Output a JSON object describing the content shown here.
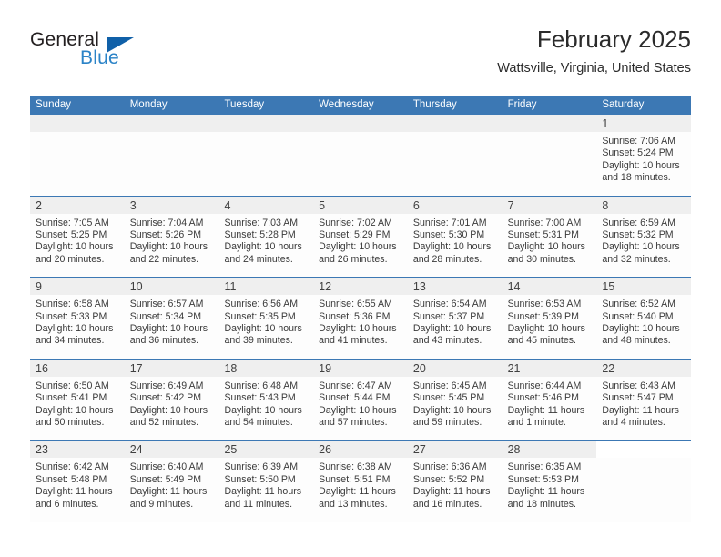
{
  "brand": {
    "name_part1": "General",
    "name_part2": "Blue",
    "accent_color": "#2b83c7",
    "triangle_color": "#1060a8"
  },
  "header": {
    "title": "February 2025",
    "location": "Wattsville, Virginia, United States"
  },
  "calendar": {
    "header_bg": "#3c78b4",
    "weekdays": [
      "Sunday",
      "Monday",
      "Tuesday",
      "Wednesday",
      "Thursday",
      "Friday",
      "Saturday"
    ],
    "weeks": [
      [
        {
          "day": "",
          "sunrise": "",
          "sunset": "",
          "daylight": "",
          "daylight2": ""
        },
        {
          "day": "",
          "sunrise": "",
          "sunset": "",
          "daylight": "",
          "daylight2": ""
        },
        {
          "day": "",
          "sunrise": "",
          "sunset": "",
          "daylight": "",
          "daylight2": ""
        },
        {
          "day": "",
          "sunrise": "",
          "sunset": "",
          "daylight": "",
          "daylight2": ""
        },
        {
          "day": "",
          "sunrise": "",
          "sunset": "",
          "daylight": "",
          "daylight2": ""
        },
        {
          "day": "",
          "sunrise": "",
          "sunset": "",
          "daylight": "",
          "daylight2": ""
        },
        {
          "day": "1",
          "sunrise": "Sunrise: 7:06 AM",
          "sunset": "Sunset: 5:24 PM",
          "daylight": "Daylight: 10 hours",
          "daylight2": "and 18 minutes."
        }
      ],
      [
        {
          "day": "2",
          "sunrise": "Sunrise: 7:05 AM",
          "sunset": "Sunset: 5:25 PM",
          "daylight": "Daylight: 10 hours",
          "daylight2": "and 20 minutes."
        },
        {
          "day": "3",
          "sunrise": "Sunrise: 7:04 AM",
          "sunset": "Sunset: 5:26 PM",
          "daylight": "Daylight: 10 hours",
          "daylight2": "and 22 minutes."
        },
        {
          "day": "4",
          "sunrise": "Sunrise: 7:03 AM",
          "sunset": "Sunset: 5:28 PM",
          "daylight": "Daylight: 10 hours",
          "daylight2": "and 24 minutes."
        },
        {
          "day": "5",
          "sunrise": "Sunrise: 7:02 AM",
          "sunset": "Sunset: 5:29 PM",
          "daylight": "Daylight: 10 hours",
          "daylight2": "and 26 minutes."
        },
        {
          "day": "6",
          "sunrise": "Sunrise: 7:01 AM",
          "sunset": "Sunset: 5:30 PM",
          "daylight": "Daylight: 10 hours",
          "daylight2": "and 28 minutes."
        },
        {
          "day": "7",
          "sunrise": "Sunrise: 7:00 AM",
          "sunset": "Sunset: 5:31 PM",
          "daylight": "Daylight: 10 hours",
          "daylight2": "and 30 minutes."
        },
        {
          "day": "8",
          "sunrise": "Sunrise: 6:59 AM",
          "sunset": "Sunset: 5:32 PM",
          "daylight": "Daylight: 10 hours",
          "daylight2": "and 32 minutes."
        }
      ],
      [
        {
          "day": "9",
          "sunrise": "Sunrise: 6:58 AM",
          "sunset": "Sunset: 5:33 PM",
          "daylight": "Daylight: 10 hours",
          "daylight2": "and 34 minutes."
        },
        {
          "day": "10",
          "sunrise": "Sunrise: 6:57 AM",
          "sunset": "Sunset: 5:34 PM",
          "daylight": "Daylight: 10 hours",
          "daylight2": "and 36 minutes."
        },
        {
          "day": "11",
          "sunrise": "Sunrise: 6:56 AM",
          "sunset": "Sunset: 5:35 PM",
          "daylight": "Daylight: 10 hours",
          "daylight2": "and 39 minutes."
        },
        {
          "day": "12",
          "sunrise": "Sunrise: 6:55 AM",
          "sunset": "Sunset: 5:36 PM",
          "daylight": "Daylight: 10 hours",
          "daylight2": "and 41 minutes."
        },
        {
          "day": "13",
          "sunrise": "Sunrise: 6:54 AM",
          "sunset": "Sunset: 5:37 PM",
          "daylight": "Daylight: 10 hours",
          "daylight2": "and 43 minutes."
        },
        {
          "day": "14",
          "sunrise": "Sunrise: 6:53 AM",
          "sunset": "Sunset: 5:39 PM",
          "daylight": "Daylight: 10 hours",
          "daylight2": "and 45 minutes."
        },
        {
          "day": "15",
          "sunrise": "Sunrise: 6:52 AM",
          "sunset": "Sunset: 5:40 PM",
          "daylight": "Daylight: 10 hours",
          "daylight2": "and 48 minutes."
        }
      ],
      [
        {
          "day": "16",
          "sunrise": "Sunrise: 6:50 AM",
          "sunset": "Sunset: 5:41 PM",
          "daylight": "Daylight: 10 hours",
          "daylight2": "and 50 minutes."
        },
        {
          "day": "17",
          "sunrise": "Sunrise: 6:49 AM",
          "sunset": "Sunset: 5:42 PM",
          "daylight": "Daylight: 10 hours",
          "daylight2": "and 52 minutes."
        },
        {
          "day": "18",
          "sunrise": "Sunrise: 6:48 AM",
          "sunset": "Sunset: 5:43 PM",
          "daylight": "Daylight: 10 hours",
          "daylight2": "and 54 minutes."
        },
        {
          "day": "19",
          "sunrise": "Sunrise: 6:47 AM",
          "sunset": "Sunset: 5:44 PM",
          "daylight": "Daylight: 10 hours",
          "daylight2": "and 57 minutes."
        },
        {
          "day": "20",
          "sunrise": "Sunrise: 6:45 AM",
          "sunset": "Sunset: 5:45 PM",
          "daylight": "Daylight: 10 hours",
          "daylight2": "and 59 minutes."
        },
        {
          "day": "21",
          "sunrise": "Sunrise: 6:44 AM",
          "sunset": "Sunset: 5:46 PM",
          "daylight": "Daylight: 11 hours",
          "daylight2": "and 1 minute."
        },
        {
          "day": "22",
          "sunrise": "Sunrise: 6:43 AM",
          "sunset": "Sunset: 5:47 PM",
          "daylight": "Daylight: 11 hours",
          "daylight2": "and 4 minutes."
        }
      ],
      [
        {
          "day": "23",
          "sunrise": "Sunrise: 6:42 AM",
          "sunset": "Sunset: 5:48 PM",
          "daylight": "Daylight: 11 hours",
          "daylight2": "and 6 minutes."
        },
        {
          "day": "24",
          "sunrise": "Sunrise: 6:40 AM",
          "sunset": "Sunset: 5:49 PM",
          "daylight": "Daylight: 11 hours",
          "daylight2": "and 9 minutes."
        },
        {
          "day": "25",
          "sunrise": "Sunrise: 6:39 AM",
          "sunset": "Sunset: 5:50 PM",
          "daylight": "Daylight: 11 hours",
          "daylight2": "and 11 minutes."
        },
        {
          "day": "26",
          "sunrise": "Sunrise: 6:38 AM",
          "sunset": "Sunset: 5:51 PM",
          "daylight": "Daylight: 11 hours",
          "daylight2": "and 13 minutes."
        },
        {
          "day": "27",
          "sunrise": "Sunrise: 6:36 AM",
          "sunset": "Sunset: 5:52 PM",
          "daylight": "Daylight: 11 hours",
          "daylight2": "and 16 minutes."
        },
        {
          "day": "28",
          "sunrise": "Sunrise: 6:35 AM",
          "sunset": "Sunset: 5:53 PM",
          "daylight": "Daylight: 11 hours",
          "daylight2": "and 18 minutes."
        },
        {
          "day": "",
          "sunrise": "",
          "sunset": "",
          "daylight": "",
          "daylight2": ""
        }
      ]
    ]
  }
}
